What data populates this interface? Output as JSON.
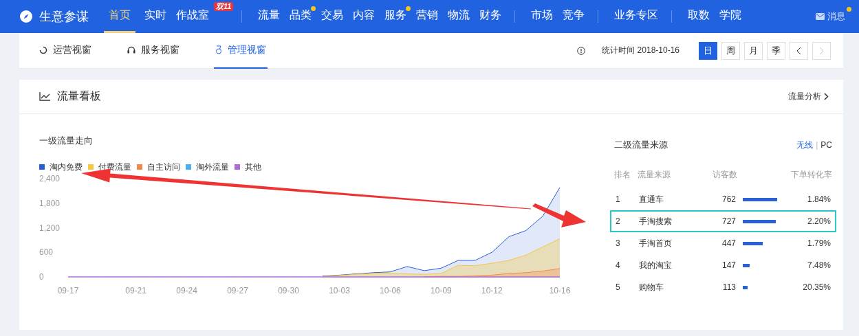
{
  "nav": {
    "brand": "生意参谋",
    "groups": [
      [
        {
          "label": "首页",
          "selected": true
        },
        {
          "label": "实时",
          "selected": false
        },
        {
          "label": "作战室",
          "selected": false,
          "badge": "双11"
        }
      ],
      [
        {
          "label": "流量",
          "selected": false
        },
        {
          "label": "品类",
          "selected": false,
          "dot": true
        },
        {
          "label": "交易",
          "selected": false
        },
        {
          "label": "内容",
          "selected": false
        },
        {
          "label": "服务",
          "selected": false,
          "dot": true
        },
        {
          "label": "营销",
          "selected": false
        },
        {
          "label": "物流",
          "selected": false
        },
        {
          "label": "财务",
          "selected": false
        }
      ],
      [
        {
          "label": "市场",
          "selected": false
        },
        {
          "label": "竞争",
          "selected": false
        }
      ],
      [
        {
          "label": "业务专区",
          "selected": false
        }
      ],
      [
        {
          "label": "取数",
          "selected": false
        },
        {
          "label": "学院",
          "selected": false
        }
      ]
    ],
    "messages": {
      "label": "消息",
      "dot": true
    }
  },
  "view_tabs": [
    {
      "label": "运营视窗",
      "selected": false
    },
    {
      "label": "服务视窗",
      "selected": false
    },
    {
      "label": "管理视窗",
      "selected": true
    }
  ],
  "stat_time": "统计时间 2018-10-16",
  "periods": [
    {
      "label": "日",
      "selected": true
    },
    {
      "label": "周",
      "selected": false
    },
    {
      "label": "月",
      "selected": false
    },
    {
      "label": "季",
      "selected": false
    }
  ],
  "pager": {
    "prev_disabled": false,
    "next_disabled": true
  },
  "panel": {
    "title": "流量看板",
    "link": "流量分析",
    "trend": {
      "title": "一级流量走向",
      "chart_data": {
        "type": "area",
        "categories": [
          "09-17",
          null,
          null,
          null,
          "09-21",
          null,
          null,
          "09-24",
          null,
          null,
          "09-27",
          null,
          null,
          "09-30",
          null,
          null,
          "10-03",
          null,
          null,
          "10-06",
          null,
          null,
          "10-09",
          null,
          null,
          "10-12",
          null,
          null,
          null,
          "10-16"
        ],
        "yticks": [
          {
            "value": 0,
            "label": "0"
          },
          {
            "value": 600,
            "label": "600"
          },
          {
            "value": 1200,
            "label": "1,200"
          },
          {
            "value": 1800,
            "label": "1,800"
          },
          {
            "value": 2400,
            "label": "2,400"
          }
        ],
        "ylim": [
          0,
          2400
        ],
        "series": [
          {
            "name": "淘内免费",
            "color": "#2a5fd6",
            "values": [
              null,
              null,
              null,
              null,
              null,
              null,
              null,
              null,
              null,
              null,
              null,
              null,
              null,
              null,
              null,
              40,
              60,
              90,
              120,
              140,
              270,
              170,
              230,
              420,
              420,
              620,
              1000,
              1150,
              1500,
              2200
            ]
          },
          {
            "name": "付费流量",
            "color": "#f5c842",
            "values": [
              null,
              null,
              null,
              null,
              null,
              null,
              null,
              null,
              null,
              null,
              null,
              null,
              null,
              null,
              null,
              30,
              50,
              80,
              100,
              110,
              90,
              80,
              100,
              300,
              290,
              350,
              420,
              550,
              750,
              950
            ]
          },
          {
            "name": "自主访问",
            "color": "#f08a4b",
            "values": [
              null,
              null,
              null,
              null,
              null,
              null,
              null,
              null,
              null,
              null,
              null,
              null,
              null,
              null,
              null,
              null,
              null,
              null,
              null,
              null,
              null,
              20,
              30,
              30,
              40,
              60,
              100,
              120,
              160,
              220
            ]
          },
          {
            "name": "淘外流量",
            "color": "#4aaef0",
            "values": [
              null,
              null,
              null,
              null,
              null,
              null,
              null,
              null,
              null,
              null,
              null,
              null,
              null,
              null,
              null,
              null,
              null,
              null,
              null,
              null,
              null,
              null,
              null,
              null,
              null,
              null,
              null,
              null,
              null,
              null
            ]
          },
          {
            "name": "其他",
            "color": "#b06ad8",
            "values": [
              20,
              20,
              20,
              20,
              20,
              20,
              20,
              20,
              20,
              20,
              20,
              20,
              20,
              20,
              20,
              20,
              20,
              20,
              20,
              20,
              20,
              20,
              20,
              20,
              20,
              20,
              20,
              20,
              20,
              20
            ]
          }
        ]
      }
    },
    "sources": {
      "title": "二级流量来源",
      "switch": [
        {
          "label": "无线",
          "selected": true
        },
        {
          "label": "PC",
          "selected": false
        }
      ],
      "switch_separator": "|",
      "columns": [
        "排名",
        "流量来源",
        "访客数",
        "下单转化率"
      ],
      "rows": [
        {
          "rank": "1",
          "source": "直通车",
          "visitors": "762",
          "rate": "1.84%",
          "highlighted": false
        },
        {
          "rank": "2",
          "source": "手淘搜索",
          "visitors": "727",
          "rate": "2.20%",
          "highlighted": true
        },
        {
          "rank": "3",
          "source": "手淘首页",
          "visitors": "447",
          "rate": "1.79%",
          "highlighted": false
        },
        {
          "rank": "4",
          "source": "我的淘宝",
          "visitors": "147",
          "rate": "7.48%",
          "highlighted": false
        },
        {
          "rank": "5",
          "source": "购物车",
          "visitors": "113",
          "rate": "20.35%",
          "highlighted": false
        }
      ]
    }
  },
  "annotations": [
    {
      "kind": "arrow"
    },
    {
      "kind": "arrow"
    }
  ]
}
